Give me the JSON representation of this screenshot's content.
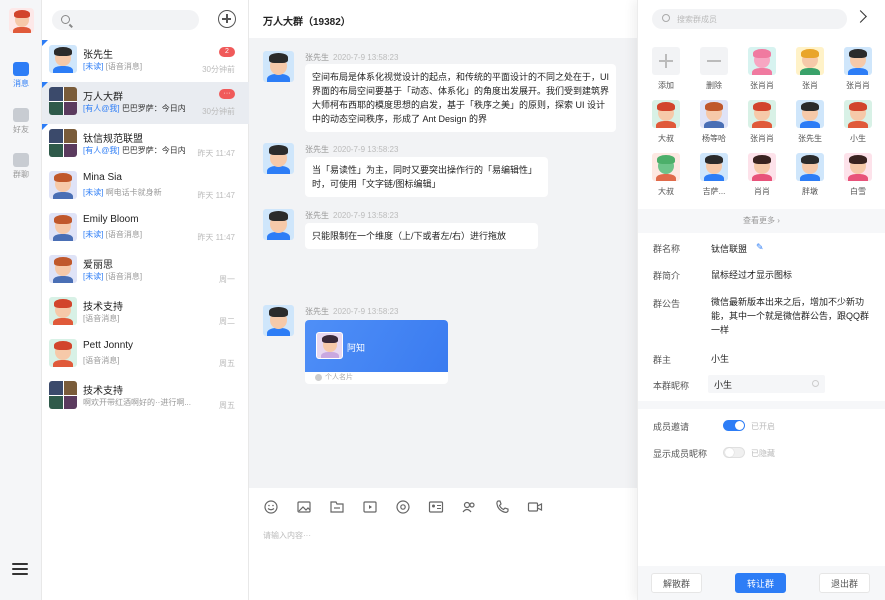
{
  "nav": {
    "items": [
      {
        "label": "消息",
        "active": true
      },
      {
        "label": "好友",
        "active": false
      },
      {
        "label": "群聊",
        "active": false
      }
    ]
  },
  "conversations": [
    {
      "name": "张先生",
      "tag": "[未读]",
      "text": "[语音消息]",
      "time": "30分钟前",
      "badge": "2",
      "avatar": "boy-blue",
      "pinned": true
    },
    {
      "name": "万人大群",
      "tag": "[有人@我]",
      "text": "巴巴罗萨：今日内",
      "time": "30分钟前",
      "badge": "···",
      "avatar": "group",
      "pinned": true,
      "selected": true
    },
    {
      "name": "钛信规范联盟",
      "tag": "[有人@我]",
      "text": "巴巴罗萨：今日内",
      "time": "昨天 11:47",
      "badge": "",
      "avatar": "group",
      "pinned": true
    },
    {
      "name": "Mina Sia",
      "tag": "[未读]",
      "text": "啊电话卡就身新",
      "time": "昨天 11:47",
      "badge": "",
      "avatar": "man-beard"
    },
    {
      "name": "Emily Bloom",
      "tag": "[未读]",
      "text": "[语音消息]",
      "time": "昨天 11:47",
      "badge": "",
      "avatar": "man-beard"
    },
    {
      "name": "爱丽思",
      "tag": "[未读]",
      "text": "[语音消息]",
      "time": "周一",
      "badge": "",
      "avatar": "man-beard"
    },
    {
      "name": "技术支持",
      "tag": "",
      "text": "[语音消息]",
      "time": "周二",
      "badge": "",
      "avatar": "girl-red"
    },
    {
      "name": "Pett Jonnty",
      "tag": "",
      "text": "[语音消息]",
      "time": "周五",
      "badge": "",
      "avatar": "girl-red"
    },
    {
      "name": "技术支持",
      "tag": "",
      "text": "啊欢开带红酒啊好的··进行啊...",
      "time": "周五",
      "badge": "",
      "avatar": "group"
    }
  ],
  "chat": {
    "title": "万人大群（19382）",
    "messages": [
      {
        "sender": "张先生",
        "time": "2020-7-9 13:58:23",
        "text": "空间布局是体系化视觉设计的起点，和传统的平面设计的不同之处在于，UI 界面的布局空间要基于「动态、体系化」的角度出发展开。我们受到建筑界大师柯布西耶的模度思想的启发，基于「秩序之美」的原则，探索 UI 设计中的动态空间秩序，形成了 Ant Design 的界"
      },
      {
        "sender": "张先生",
        "time": "2020-7-9 13:58:23",
        "text": "当「易读性」为主，同时又要突出操作行的「易编辑性」时，可使用「文字链/图标编辑」"
      },
      {
        "sender": "张先生",
        "time": "2020-7-9 13:58:23",
        "text": "只能限制在一个维度（上/下或者左/右）进行拖放"
      },
      {
        "sender": "张先生",
        "time": "2020-7-9 13:58:23",
        "card_name": "阿知",
        "card_label": "个人名片"
      }
    ],
    "composer_placeholder": "请输入内容···",
    "tools": [
      "emoji-icon",
      "image-icon",
      "file-icon",
      "video-file-icon",
      "at-icon",
      "contact-card-icon",
      "group-icon",
      "phone-icon",
      "video-call-icon"
    ]
  },
  "panel": {
    "search_placeholder": "搜索群成员",
    "members": [
      {
        "name": "添加",
        "type": "add"
      },
      {
        "name": "删除",
        "type": "remove"
      },
      {
        "name": "张肖肖",
        "avatar": "unicorn"
      },
      {
        "name": "张肖",
        "avatar": "girl-yellow"
      },
      {
        "name": "张肖肖",
        "avatar": "boy-blue"
      },
      {
        "name": "大叔",
        "avatar": "girl-red"
      },
      {
        "name": "杨等哈",
        "avatar": "man-beard"
      },
      {
        "name": "张肖肖",
        "avatar": "girl-red"
      },
      {
        "name": "张先生",
        "avatar": "boy-blue"
      },
      {
        "name": "小生",
        "avatar": "girl-red"
      },
      {
        "name": "大叔",
        "avatar": "cactus"
      },
      {
        "name": "吉萨...",
        "avatar": "boy-blue"
      },
      {
        "name": "肖肖",
        "avatar": "girl-pink"
      },
      {
        "name": "胖墩",
        "avatar": "boy-blue"
      },
      {
        "name": "白雪",
        "avatar": "girl-pink"
      }
    ],
    "view_more": "查看更多",
    "group_name_label": "群名称",
    "group_name": "钛信联盟",
    "intro_label": "群简介",
    "intro": "鼠标经过才显示图标",
    "notice_label": "群公告",
    "notice": "微信最新版本出来之后，增加不少新功能，其中一个就是微信群公告，跟QQ群一样",
    "owner_label": "群主",
    "owner": "小生",
    "nick_label": "本群昵称",
    "nick": "小生",
    "invite_label": "成员邀请",
    "invite_state": "已开启",
    "invite_on": true,
    "show_nick_label": "显示成员昵称",
    "show_nick_state": "已隐藏",
    "show_nick_on": false,
    "buttons": {
      "dissolve": "解散群",
      "transfer": "转让群",
      "quit": "退出群"
    }
  }
}
